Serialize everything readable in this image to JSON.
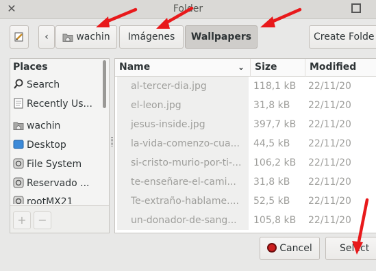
{
  "window": {
    "title": "Folder"
  },
  "toolbar": {
    "path": [
      "wachin",
      "Imágenes",
      "Wallpapers"
    ],
    "create_folder_label": "Create Folde"
  },
  "places": {
    "header": "Places",
    "items": [
      {
        "label": "Search",
        "icon": "search-icon"
      },
      {
        "label": "Recently Us...",
        "icon": "recent-icon"
      },
      {
        "label": "wachin",
        "icon": "home-folder-icon"
      },
      {
        "label": "Desktop",
        "icon": "desktop-icon"
      },
      {
        "label": "File System",
        "icon": "drive-icon"
      },
      {
        "label": "Reservado ...",
        "icon": "drive-icon"
      },
      {
        "label": "rootMX21",
        "icon": "drive-icon"
      }
    ],
    "add_label": "+",
    "remove_label": "−"
  },
  "files": {
    "columns": {
      "name": "Name",
      "size": "Size",
      "modified": "Modified"
    },
    "rows": [
      {
        "name": "al-tercer-dia.jpg",
        "size": "118,1 kB",
        "modified": "22/11/20"
      },
      {
        "name": "el-leon.jpg",
        "size": "31,8 kB",
        "modified": "22/11/20"
      },
      {
        "name": "jesus-inside.jpg",
        "size": "397,7 kB",
        "modified": "22/11/20"
      },
      {
        "name": "la-vida-comenzo-cua...",
        "size": "44,5 kB",
        "modified": "22/11/20"
      },
      {
        "name": "si-cristo-murio-por-ti-...",
        "size": "106,2 kB",
        "modified": "22/11/20"
      },
      {
        "name": "te-enseñare-el-cami...",
        "size": "31,8 kB",
        "modified": "22/11/20"
      },
      {
        "name": "Te-extraño-hablame....",
        "size": "52,5 kB",
        "modified": "22/11/20"
      },
      {
        "name": "un-donador-de-sang...",
        "size": "105,8 kB",
        "modified": "22/11/20"
      }
    ]
  },
  "actions": {
    "cancel_label": "Cancel",
    "select_label": "Select"
  },
  "colors": {
    "annotation_arrow": "#e8191b",
    "cancel_icon": "#cc1f1f"
  }
}
